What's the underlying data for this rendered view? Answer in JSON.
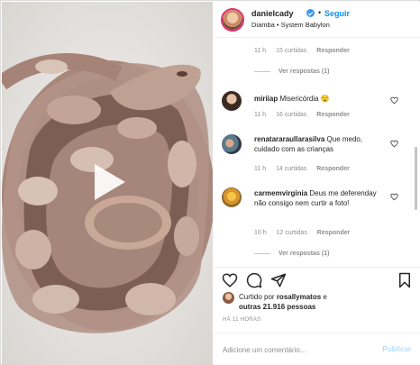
{
  "post": {
    "username": "danielcady",
    "verified": true,
    "separator": "•",
    "follow_label": "Seguir",
    "location": "Diamba • System Babylon",
    "more_icon": "more-options-icon"
  },
  "comments": [
    {
      "partial": true,
      "time": "11 h",
      "likes": "15 curtidas",
      "reply": "Responder",
      "view_replies": "Ver respostas (1)"
    },
    {
      "username": "miriiap",
      "text": "Misericórdia 😯",
      "time": "11 h",
      "likes": "16 curtidas",
      "reply": "Responder"
    },
    {
      "username": "renatararaullarasilva",
      "text": "Que medo, cuidado com as crianças",
      "time": "11 h",
      "likes": "14 curtidas",
      "reply": "Responder"
    },
    {
      "username": "carmemvirginia",
      "text": "Deus me deferenday não consigo nem curtir a foto!",
      "time": "10 h",
      "likes": "12 curtidas",
      "reply": "Responder",
      "view_replies": "Ver respostas (1)"
    }
  ],
  "actions": {
    "like_icon": "heart-icon",
    "comment_icon": "comment-icon",
    "share_icon": "share-icon",
    "save_icon": "bookmark-icon"
  },
  "likes": {
    "prefix": "Curtido por",
    "user": "rosallymatos",
    "connector": "e",
    "others": "outras 21.916 pessoas"
  },
  "time_ago": "HÁ 11 HORAS",
  "add_comment": {
    "placeholder": "Adicione um comentário...",
    "publish_label": "Publicar"
  },
  "colors": {
    "accent": "#0095f6",
    "publish_disabled": "#b2dffc",
    "muted_text": "#8e8e8e"
  }
}
